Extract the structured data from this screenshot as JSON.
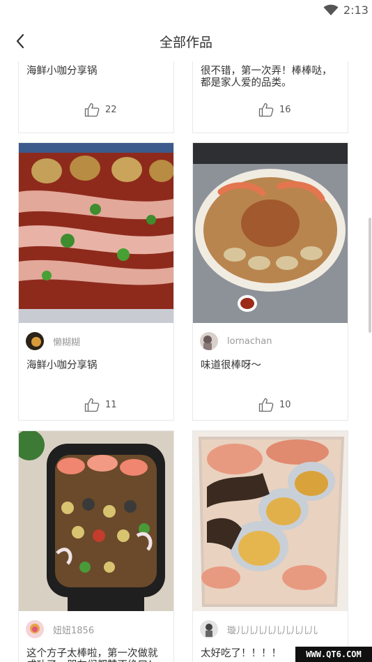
{
  "status_bar": {
    "time": "2:13"
  },
  "header": {
    "title": "全部作品"
  },
  "cards": [
    {
      "author": "",
      "description": "海鲜小咖分享锅",
      "likes": "22"
    },
    {
      "author": "",
      "description": "很不错，第一次弄！棒棒哒，都是家人爱的品类。",
      "likes": "16"
    },
    {
      "author": "懒糊糊",
      "description": "海鲜小咖分享锅",
      "likes": "11"
    },
    {
      "author": "lornachan",
      "description": "味道很棒呀～",
      "likes": "10"
    },
    {
      "author": "妞妞1856",
      "description": "这个方子太棒啦，第一次做就成功了，朋友们都赞不绝口！",
      "likes": ""
    },
    {
      "author": "璇儿儿儿儿儿儿儿儿儿",
      "description": "太好吃了！！！！",
      "likes": ""
    }
  ],
  "watermark": "WWW.QT6.COM",
  "icons": {
    "back": "chevron-left-icon",
    "like": "thumbs-up-icon",
    "wifi": "wifi-icon"
  }
}
